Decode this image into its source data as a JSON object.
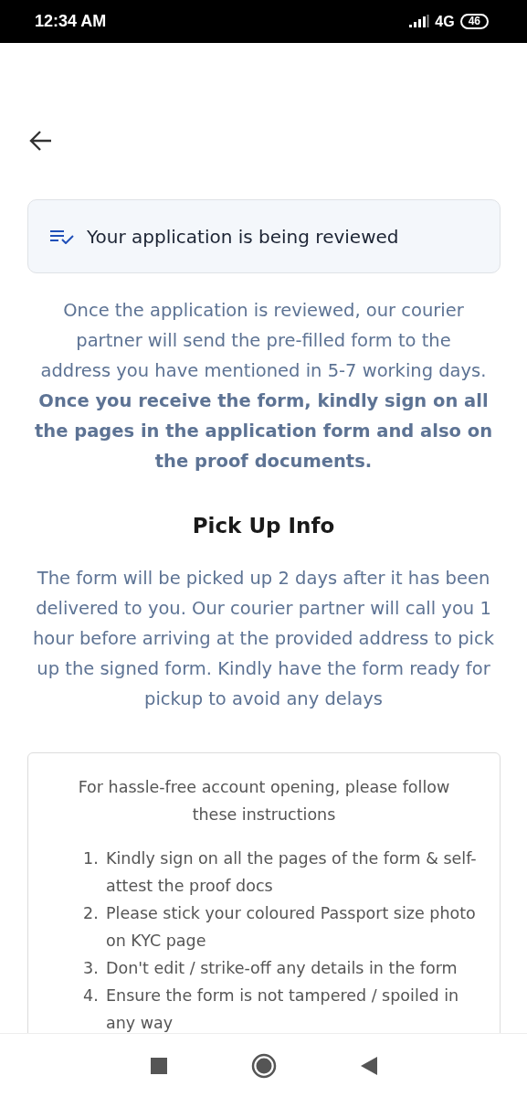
{
  "status_bar": {
    "time": "12:34 AM",
    "network": "4G",
    "battery": "46"
  },
  "banner": {
    "text": "Your application is being reviewed"
  },
  "intro": {
    "text": "Once the application is reviewed, our courier partner will send the pre-filled form to the address you have mentioned in 5-7 working days.",
    "note": "Once you receive the form, kindly sign on all the pages in the application form and also on the proof documents."
  },
  "pickup": {
    "title": "Pick Up Info",
    "text": "The form will be picked up 2 days after it has been delivered to you. Our courier partner will call you 1 hour before arriving at the provided address to pick up the signed form. Kindly have the form ready for pickup to avoid any delays"
  },
  "instructions": {
    "heading": "For hassle-free account opening, please follow these instructions",
    "items": [
      {
        "number": "1.",
        "text": "Kindly sign on all the pages of the form & self-attest the proof docs"
      },
      {
        "number": "2.",
        "text": "Please stick your coloured Passport size photo on KYC page"
      },
      {
        "number": "3.",
        "text": "Don't edit / strike-off any details in the form"
      },
      {
        "number": "4.",
        "text": "Ensure the form is not tampered / spoiled in any way"
      }
    ]
  }
}
